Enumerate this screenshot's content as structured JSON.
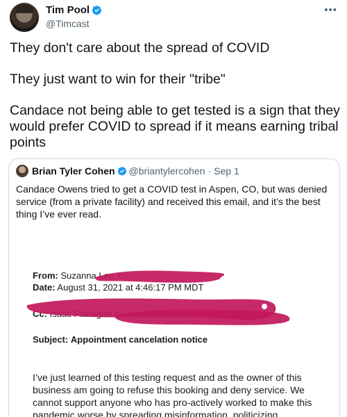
{
  "tweet": {
    "author_name": "Tim Pool",
    "author_handle": "@Timcast",
    "more_icon": "•••",
    "text_lines": [
      "They don't care about the spread of COVID",
      "They just want to win for their \"tribe\"",
      "Candace not being able to get tested is a sign that they would prefer COVID to spread if it means earning tribal points"
    ]
  },
  "quote": {
    "author_name": "Brian Tyler Cohen",
    "author_handle": "@briantylercohen",
    "separator": "·",
    "date": "Sep 1",
    "text": "Candace Owens tried to get a COVID test in Aspen, CO, but was denied service (from a private facility) and received this email, and it’s the best thing I’ve ever read.",
    "email": {
      "from_label": "From:",
      "from_value": "Suzanna Lee <",
      "date_label": "Date:",
      "date_value": "August 31, 2021 at 4:46:17 PM MDT",
      "cc_label": "Cc:",
      "cc_value": "Isaac Flanagan <i",
      "subject_label": "Subject:",
      "subject_value": "Appointment cancelation notice",
      "body": "I’ve just learned of this testing request and as the owner of this business am going to refuse this booking and deny service. We cannot support anyone who has pro-actively worked to make this pandemic worse by spreading misinformation, politicizing"
    }
  },
  "colors": {
    "verified": "#1d9bf0",
    "redaction": "#c2185b",
    "border": "#cfd9de",
    "secondary_text": "#536471"
  }
}
